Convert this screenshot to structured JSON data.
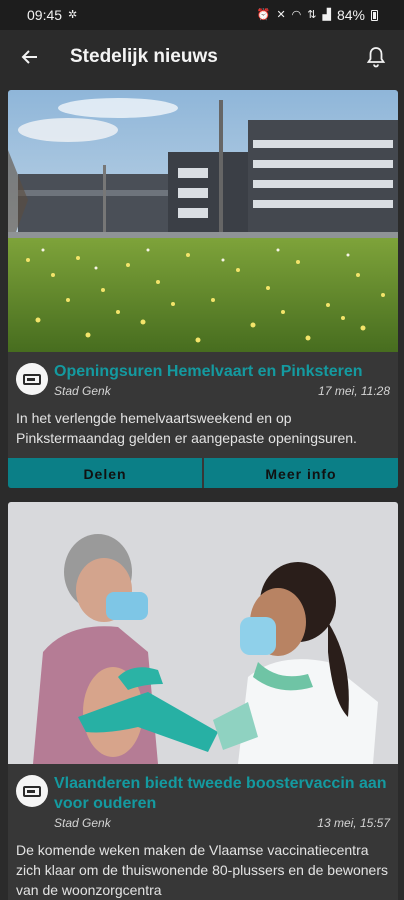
{
  "status_bar": {
    "time": "09:45",
    "battery": "84%"
  },
  "app_bar": {
    "title": "Stedelijk nieuws"
  },
  "articles": [
    {
      "title": "Openingsuren Hemelvaart en Pinksteren",
      "source": "Stad Genk",
      "date": "17 mei, 11:28",
      "summary": "In het verlengde hemelvaartsweekend en op Pinkstermaandag gelden er aangepaste openingsuren.",
      "share_label": "Delen",
      "more_label": "Meer info"
    },
    {
      "title": "Vlaanderen biedt tweede boostervaccin aan voor ouderen",
      "source": "Stad Genk",
      "date": "13 mei, 15:57",
      "summary": "De komende weken maken de Vlaamse vaccinatiecentra zich klaar om de thuiswonende 80-plussers en de bewoners van de woonzorgcentra"
    }
  ],
  "icons": {
    "back": "arrow-left-icon",
    "notifications": "bell-icon",
    "source_logo": "stad-genk-logo"
  },
  "colors": {
    "accent": "#149aa0",
    "button": "#0b7f87",
    "background": "#2b2b2b",
    "card": "#373737"
  }
}
